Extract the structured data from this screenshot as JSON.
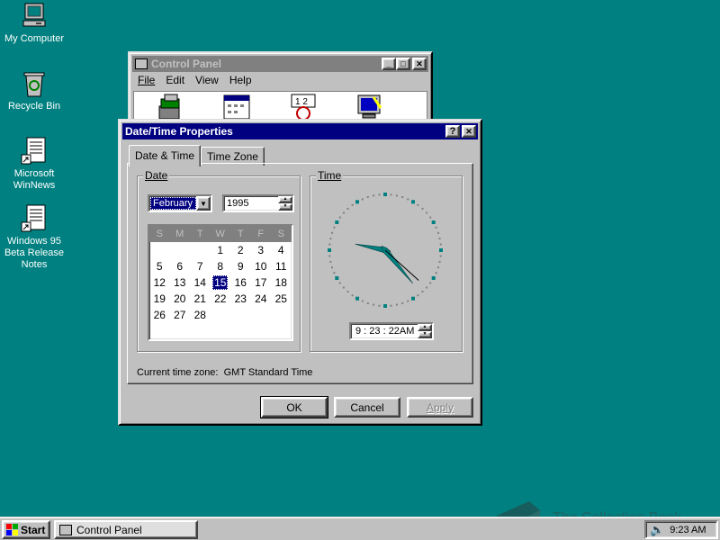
{
  "desktop": {
    "icons": [
      {
        "label": "My Computer",
        "icon": "my-computer-icon"
      },
      {
        "label": "Recycle Bin",
        "icon": "recycle-bin-icon"
      },
      {
        "label": "Microsoft WinNews",
        "icon": "document-shortcut-icon"
      },
      {
        "label": "Windows 95 Beta Release Notes",
        "icon": "document-shortcut-icon"
      }
    ],
    "watermark": "The Collection Book"
  },
  "control_panel": {
    "title": "Control Panel",
    "menu": [
      "File",
      "Edit",
      "View",
      "Help"
    ]
  },
  "dialog": {
    "title": "Date/Time Properties",
    "tabs": [
      "Date & Time",
      "Time Zone"
    ],
    "date_group_label": "Date",
    "time_group_label": "Time",
    "month": "February",
    "year": "1995",
    "day_headers": [
      "S",
      "M",
      "T",
      "W",
      "T",
      "F",
      "S"
    ],
    "days": [
      [
        "",
        "",
        "",
        "1",
        "2",
        "3",
        "4"
      ],
      [
        "5",
        "6",
        "7",
        "8",
        "9",
        "10",
        "11"
      ],
      [
        "12",
        "13",
        "14",
        "15",
        "16",
        "17",
        "18"
      ],
      [
        "19",
        "20",
        "21",
        "22",
        "23",
        "24",
        "25"
      ],
      [
        "26",
        "27",
        "28",
        "",
        "",
        "",
        ""
      ]
    ],
    "selected_day": "15",
    "clock": {
      "hour": 9,
      "minute": 23,
      "second": 22
    },
    "time_text": "9 : 23 : 22AM",
    "timezone_label": "Current time zone:  GMT Standard Time",
    "ok_label": "OK",
    "cancel_label": "Cancel",
    "apply_label": "Apply",
    "help_label": "?",
    "close_label": "✕"
  },
  "taskbar": {
    "start_label": "Start",
    "task_label": "Control Panel",
    "clock": "9:23 AM"
  },
  "colors": {
    "desktop": "#008080",
    "title_active": "#000080",
    "title_inactive": "#808080",
    "clock_dots": "#008080"
  }
}
